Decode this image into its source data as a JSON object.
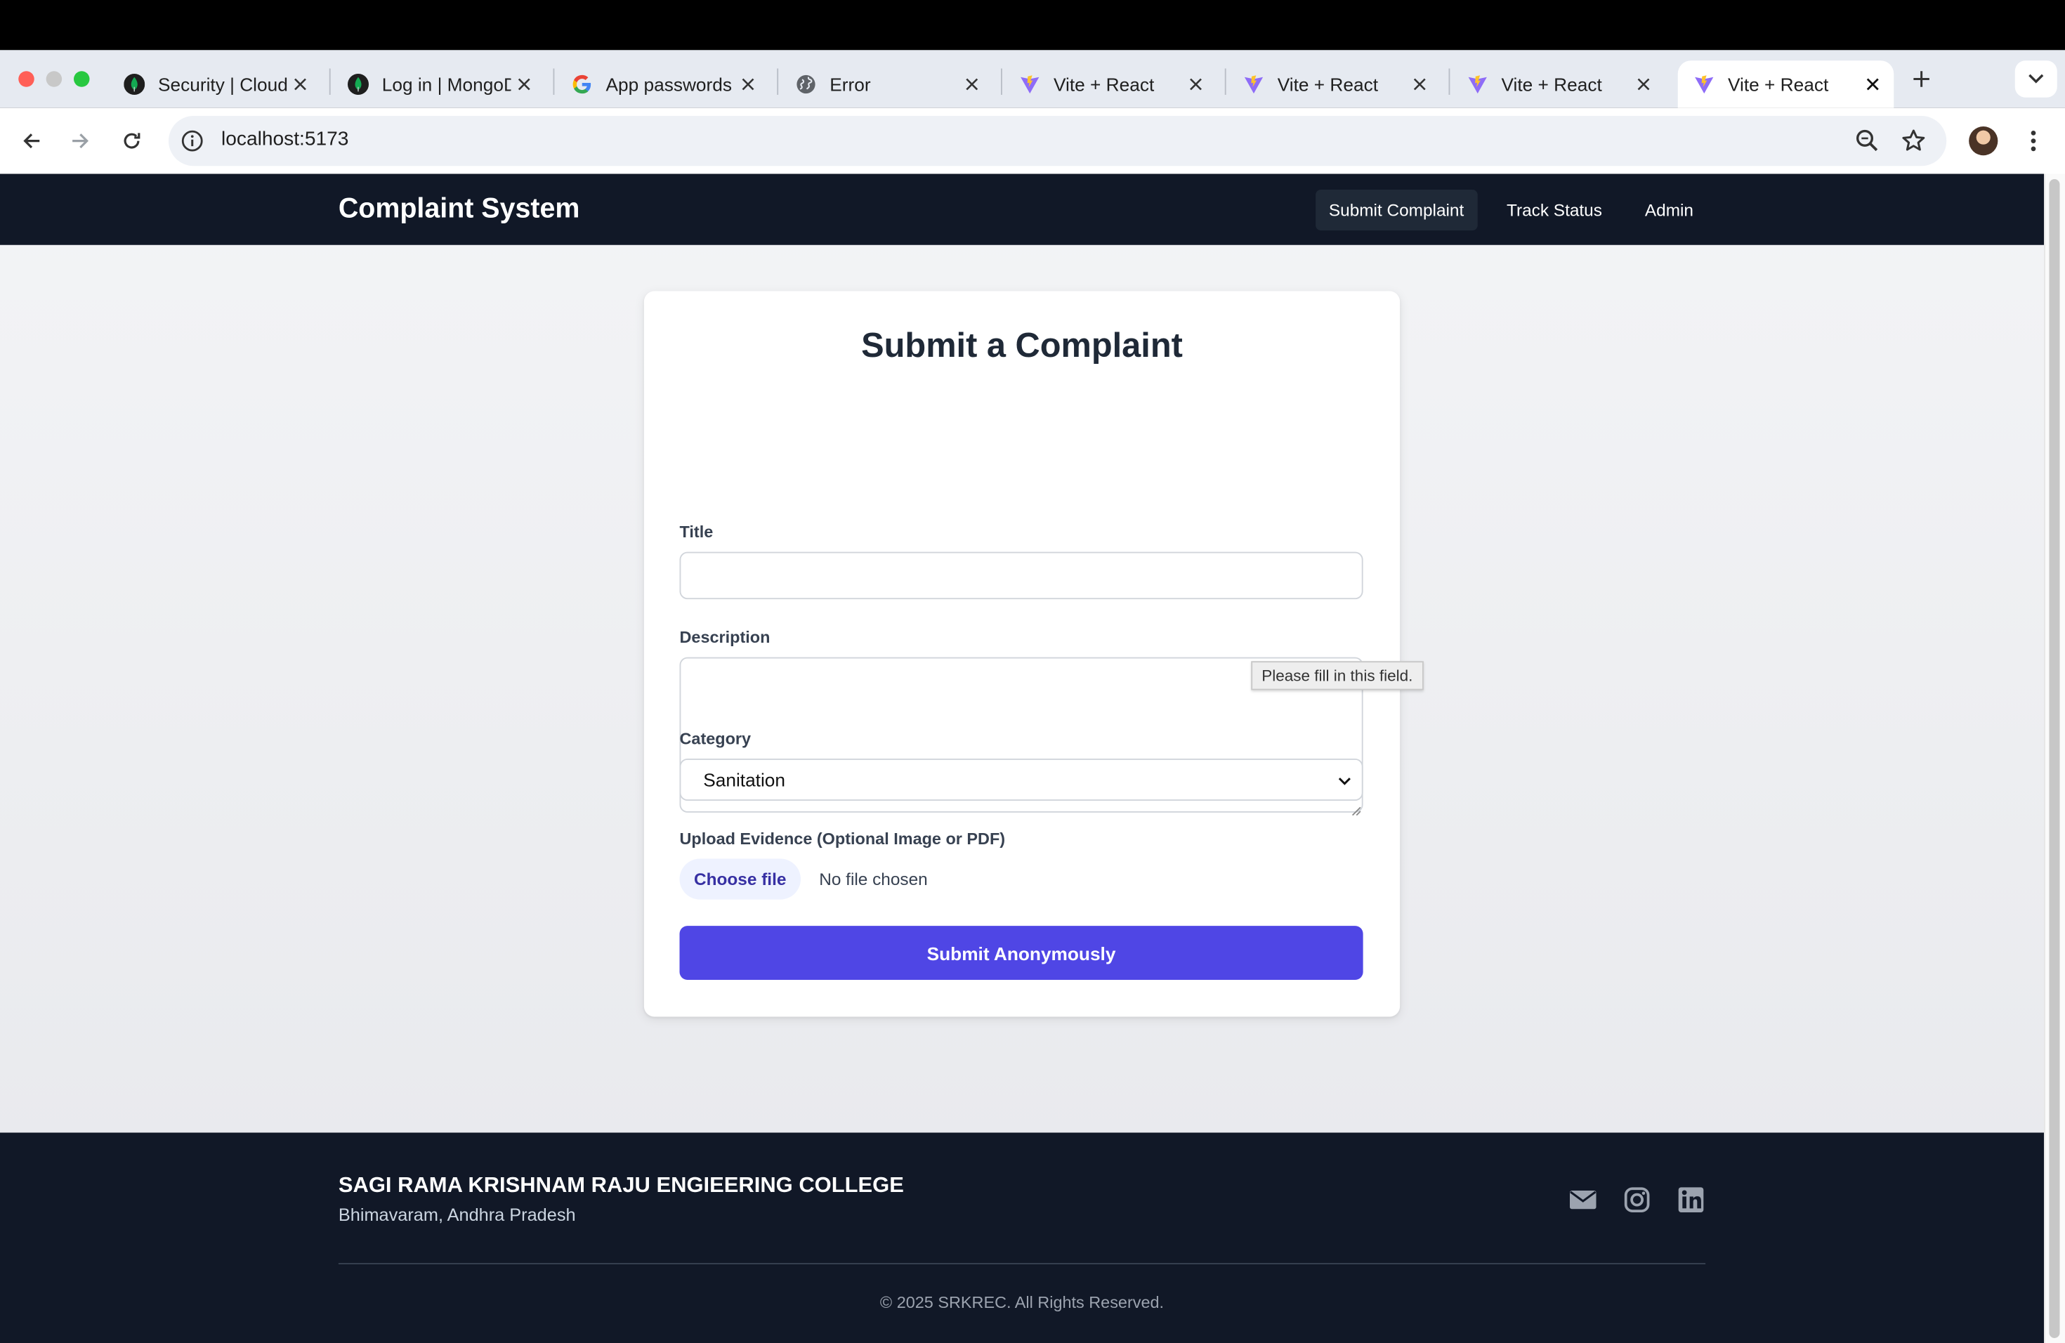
{
  "browser": {
    "tabs": [
      {
        "title": "Security | Cloud",
        "icon": "mongodb-leaf-icon"
      },
      {
        "title": "Log in | MongoD",
        "icon": "mongodb-leaf-icon"
      },
      {
        "title": "App passwords",
        "icon": "google-g-icon"
      },
      {
        "title": "Error",
        "icon": "globe-icon"
      },
      {
        "title": "Vite + React",
        "icon": "vite-icon"
      },
      {
        "title": "Vite + React",
        "icon": "vite-icon"
      },
      {
        "title": "Vite + React",
        "icon": "vite-icon"
      },
      {
        "title": "Vite + React",
        "icon": "vite-icon",
        "active": true
      }
    ],
    "url": "localhost:5173"
  },
  "app": {
    "brand": "Complaint System",
    "nav": [
      {
        "label": "Submit Complaint",
        "active": true
      },
      {
        "label": "Track Status"
      },
      {
        "label": "Admin"
      }
    ]
  },
  "form": {
    "heading": "Submit a Complaint",
    "title_label": "Title",
    "title_value": "",
    "description_label": "Description",
    "description_value": "",
    "category_label": "Category",
    "category_value": "Sanitation",
    "upload_label": "Upload Evidence (Optional Image or PDF)",
    "choose_file_label": "Choose file",
    "no_file_text": "No file chosen",
    "submit_label": "Submit Anonymously",
    "validation_tooltip": "Please fill in this field."
  },
  "footer": {
    "college_name": "SAGI RAMA KRISHNAM RAJU ENGIEERING COLLEGE",
    "location": "Bhimavaram, Andhra Pradesh",
    "copyright": "© 2025 SRKREC. All Rights Reserved.",
    "social_icons": [
      "envelope-icon",
      "instagram-icon",
      "linkedin-icon"
    ]
  },
  "colors": {
    "nav_bg": "#111827",
    "primary": "#4f46e5",
    "choose_file_bg": "#eef2ff",
    "choose_file_text": "#3730a3"
  }
}
